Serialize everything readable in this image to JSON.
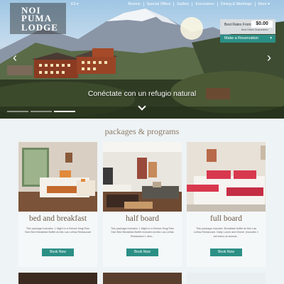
{
  "header": {
    "logo_line1": "NOI",
    "logo_line2": "PUMA",
    "logo_line3": "LODGE",
    "language": "ES ▾",
    "nav": [
      "Rooms",
      "Special Offers",
      "Gallery",
      "Excursions",
      "Dining & Meetings",
      "More ▾"
    ]
  },
  "rates": {
    "label": "Best Rates From:",
    "amount": "$0.00",
    "sub": "Best Rates Guaranteed",
    "reserve_label": "Make a Reservation",
    "reserve_caret": "▾"
  },
  "hero": {
    "tagline": "Conéctate con un refugio natural",
    "prev_arrow": "‹",
    "next_arrow": "›",
    "slide_count": 3,
    "active_slide": 2
  },
  "section": {
    "title": "packages & programs"
  },
  "cards": [
    {
      "title": "bed and breakfast",
      "desc": "This package includes: 1 Night in a Deluxe King/Twin Size Bed Breakfast Buffet at Alto Las Leñas Restaurant",
      "button": "Book Now"
    },
    {
      "title": "half board",
      "desc": "This package includes: 1 Night in a Deluxe King/Twin Size Bed Breakfast Buffet included at Alto Las Leñas Restaurant 1 dinn...",
      "button": "Book Now"
    },
    {
      "title": "full board",
      "desc": "This package includes: Breakfast buffet at Alto Las Leñas Restaurant. Daily Lunch and Dinner (includes 1 set-menu at annual...",
      "button": "Book Now"
    }
  ],
  "colors": {
    "accent": "#2c8f86",
    "heading": "#8a7a66",
    "card_title": "#6b5a46"
  }
}
